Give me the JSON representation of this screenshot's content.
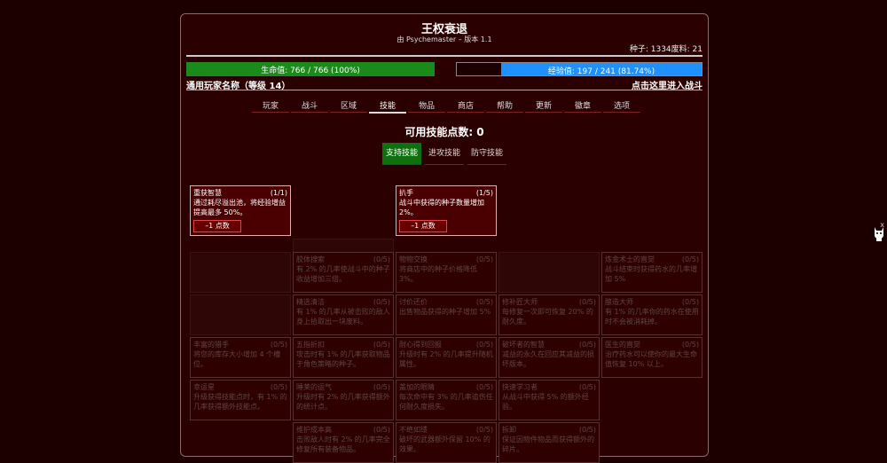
{
  "header": {
    "title": "王权衰退",
    "subtitle": "由 Psychemaster – 版本 1.1",
    "seed_label": "种子: 1334废料: 21"
  },
  "hp": {
    "label": "生命值: 766 / 766 (100%)",
    "fraction": 1.0
  },
  "xp": {
    "label": "经验值: 197 / 241 (81.74%)",
    "fraction": 0.8174
  },
  "player": {
    "name": "通用玩家名称（等级 14）",
    "enter_battle": "点击这里进入战斗"
  },
  "tabs": [
    "玩家",
    "战斗",
    "区域",
    "技能",
    "物品",
    "商店",
    "帮助",
    "更新",
    "徽章",
    "选项"
  ],
  "active_tab": "技能",
  "skill_points": "可用技能点数: 0",
  "skill_tabs": [
    "支持技能",
    "进攻技能",
    "防守技能"
  ],
  "cards": [
    {
      "name": "重获智慧",
      "level": "(1/1)",
      "desc": "通过耗尽溢出池，将经验增益提高最多 50%。",
      "button": "–1 点数"
    },
    {
      "name": "扒手",
      "level": "(1/5)",
      "desc": "战斗中获得的种子数量增加 2%。",
      "button": "–1 点数"
    },
    {
      "name": "胶体搜索",
      "level": "(0/5)",
      "desc": "有 2% 的几率使战斗中的种子收益增加三倍。"
    },
    {
      "name": "物物交换",
      "level": "(0/5)",
      "desc": "将商店中的种子价格降低 3%。"
    },
    {
      "name": "炼金术士的直觉",
      "level": "(0/5)",
      "desc": "战斗结束时获得药水的几率增加 5%"
    },
    {
      "name": "精选清洁",
      "level": "(0/5)",
      "desc": "有 1% 的几率从被击败的敌人身上拾取出一块废料。"
    },
    {
      "name": "讨价还价",
      "level": "(0/5)",
      "desc": "出售物品获得的种子增加 5%"
    },
    {
      "name": "修补匠大师",
      "level": "(0/5)",
      "desc": "每修复一次即可恢复 20% 的耐久度。"
    },
    {
      "name": "酿造大师",
      "level": "(0/5)",
      "desc": "有 1% 的几率你的药水在使用时不会被消耗掉。"
    },
    {
      "name": "丰富的猎手",
      "level": "(0/5)",
      "desc": "将您的库存大小增加 4 个槽位。"
    },
    {
      "name": "五指折扣",
      "level": "(0/5)",
      "desc": "攻击时有 1% 的几率获取物品于角色策略的种子。"
    },
    {
      "name": "耐心得到回报",
      "level": "(0/5)",
      "desc": "升级时有 2% 的几率提升随机属性。"
    },
    {
      "name": "破坏者的智慧",
      "level": "(0/5)",
      "desc": "减益的永久在回应其减益的损坏版本。"
    },
    {
      "name": "医生的直觉",
      "level": "(0/5)",
      "desc": "治疗药水可以使你的最大生命值恢复 10% 以上。"
    },
    {
      "name": "幸运星",
      "level": "(0/5)",
      "desc": "升级获得技能点时，有 1% 的几率获得额外技能点。"
    },
    {
      "name": "睡莱的运气",
      "level": "(0/5)",
      "desc": "升级时有 2% 的几率获得额外的统计点。"
    },
    {
      "name": "盖加的眼睛",
      "level": "(0/5)",
      "desc": "每次命中有 3% 的几率追伤任何耐久度损失。"
    },
    {
      "name": "快速学习者",
      "level": "(0/5)",
      "desc": "从战斗中获得 5% 的额外经验。"
    },
    {
      "name": "维护成本高",
      "level": "(0/5)",
      "desc": "击败敌人时有 2% 的几率完全修复所有装备物品。"
    },
    {
      "name": "不绝如缕",
      "level": "(0/5)",
      "desc": "破坏的武器额外保留 10% 的效果。"
    },
    {
      "name": "拆卸",
      "level": "(0/5)",
      "desc": "保证因物件物品而获得额外的碎片。"
    }
  ]
}
